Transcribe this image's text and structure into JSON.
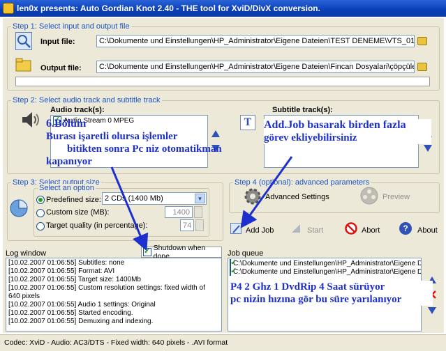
{
  "window": {
    "title": "len0x presents: Auto Gordian Knot 2.40 - THE tool for XviD/DivX conversion."
  },
  "step1": {
    "label": "Step 1: Select input and output file",
    "input_label": "Input file:",
    "input_value": "C:\\Dokumente und Einstellungen\\HP_Administrator\\Eigene Dateien\\TEST DENEME\\VTS_01_1.VOB",
    "output_label": "Output file:",
    "output_value": "C:\\Dokumente und Einstellungen\\HP_Administrator\\Eigene Dateien\\Fincan Dosyalari\\çöpçülerölmez\\Der"
  },
  "step2": {
    "label": "Step 2: Select audio track and subtitle track",
    "audio_label": "Audio track(s):",
    "audio_item": "Audio Stream 0 MPEG",
    "subtitle_label": "Subtitle track(s):"
  },
  "step3": {
    "label": "Step 3: Select output size",
    "option_label": "Select an option",
    "predefined_label": "Predefined size:",
    "predefined_value": "2 CDs (1400 Mb)",
    "custom_label": "Custom size (MB):",
    "custom_value": "1400",
    "quality_label": "Target quality (in percentage):",
    "quality_value": "74"
  },
  "step4": {
    "label": "Step 4 (optional): advanced parameters",
    "advanced_label": "Advanced Settings",
    "preview_label": "Preview"
  },
  "actions": {
    "add_job": "Add Job",
    "start": "Start",
    "abort": "Abort",
    "about": "About"
  },
  "log": {
    "label": "Log window",
    "shutdown_label": "Shutdown when done",
    "lines": [
      "[10.02.2007 01:06:55] Subtitles: none",
      "[10.02.2007 01:06:55] Format: AVI",
      "[10.02.2007 01:06:55] Target size: 1400Mb",
      "[10.02.2007 01:06:55] Custom resolution settings: fixed width of",
      "640 pixels",
      "[10.02.2007 01:06:55] Audio 1 settings: Original",
      "[10.02.2007 01:06:55] Started encoding.",
      "[10.02.2007 01:06:55] Demuxing and indexing."
    ]
  },
  "queue": {
    "label": "Job queue",
    "items": [
      "C:\\Dokumente und Einstellungen\\HP_Administrator\\Eigene D",
      "C:\\Dokumente und Einstellungen\\HP_Administrator\\Eigene D"
    ]
  },
  "annotations": {
    "a1_line1": "6.Bölüm",
    "a1_line2": "Burası işaretli olursa işlemler",
    "a1_line3": "bitikten sonra Pc niz otomatikman",
    "a1_line4": "kapanıyor",
    "a2_line1": "Add.Job basarak birden fazla",
    "a2_line2": "görev ekliyebilirsiniz",
    "a3_line1": "P4 2 Ghz 1 DvdRip 4 Saat sürüyor",
    "a3_line2": "pc nizin hızına gör bu süre yarılanıyor"
  },
  "status": {
    "text": "Codec: XviD -  Audio: AC3/DTS -  Fixed width: 640 pixels  - .AVI format"
  },
  "colors": {
    "title_bar": "#0a3fb6",
    "group_label": "#1a52c9",
    "annotation": "#1d2fcc",
    "window_bg": "#ece9d8"
  }
}
